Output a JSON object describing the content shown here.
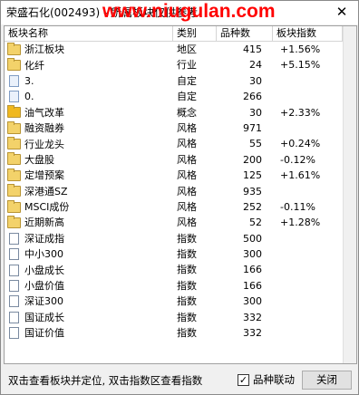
{
  "window": {
    "title": "荣盛石化(002493) - 所属板块仅供参考",
    "watermark": "www.niugulan.com",
    "close_glyph": "✕"
  },
  "table": {
    "columns": [
      "板块名称",
      "类别",
      "品种数",
      "板块指数"
    ],
    "rows": [
      {
        "icon": "folder",
        "name": "浙江板块",
        "category": "地区",
        "count": "415",
        "index": "+1.56%"
      },
      {
        "icon": "folder",
        "name": "化纤",
        "category": "行业",
        "count": "24",
        "index": "+5.15%"
      },
      {
        "icon": "doc-blue",
        "name": "3.",
        "category": "自定",
        "count": "30",
        "index": ""
      },
      {
        "icon": "doc-blue",
        "name": "0.",
        "category": "自定",
        "count": "266",
        "index": ""
      },
      {
        "icon": "folder-dark",
        "name": "油气改革",
        "category": "概念",
        "count": "30",
        "index": "+2.33%"
      },
      {
        "icon": "folder",
        "name": "融资融券",
        "category": "风格",
        "count": "971",
        "index": ""
      },
      {
        "icon": "folder",
        "name": "行业龙头",
        "category": "风格",
        "count": "55",
        "index": "+0.24%"
      },
      {
        "icon": "folder",
        "name": "大盘股",
        "category": "风格",
        "count": "200",
        "index": "-0.12%"
      },
      {
        "icon": "folder",
        "name": "定增预案",
        "category": "风格",
        "count": "125",
        "index": "+1.61%"
      },
      {
        "icon": "folder",
        "name": "深港通SZ",
        "category": "风格",
        "count": "935",
        "index": ""
      },
      {
        "icon": "folder",
        "name": "MSCI成份",
        "category": "风格",
        "count": "252",
        "index": "-0.11%"
      },
      {
        "icon": "folder",
        "name": "近期新高",
        "category": "风格",
        "count": "52",
        "index": "+1.28%"
      },
      {
        "icon": "doc",
        "name": "深证成指",
        "category": "指数",
        "count": "500",
        "index": ""
      },
      {
        "icon": "doc",
        "name": "中小300",
        "category": "指数",
        "count": "300",
        "index": ""
      },
      {
        "icon": "doc",
        "name": "小盘成长",
        "category": "指数",
        "count": "166",
        "index": ""
      },
      {
        "icon": "doc",
        "name": "小盘价值",
        "category": "指数",
        "count": "166",
        "index": ""
      },
      {
        "icon": "doc",
        "name": "深证300",
        "category": "指数",
        "count": "300",
        "index": ""
      },
      {
        "icon": "doc",
        "name": "国证成长",
        "category": "指数",
        "count": "332",
        "index": ""
      },
      {
        "icon": "doc",
        "name": "国证价值",
        "category": "指数",
        "count": "332",
        "index": ""
      }
    ]
  },
  "status": {
    "hint": "双击查看板块并定位, 双击指数区查看指数",
    "link_checkbox_label": "品种联动",
    "link_checked": true,
    "close_button": "关闭"
  },
  "colors": {
    "watermark": "#ff0000",
    "folder": "#f3d26a",
    "folder_dark": "#f0b81e"
  }
}
